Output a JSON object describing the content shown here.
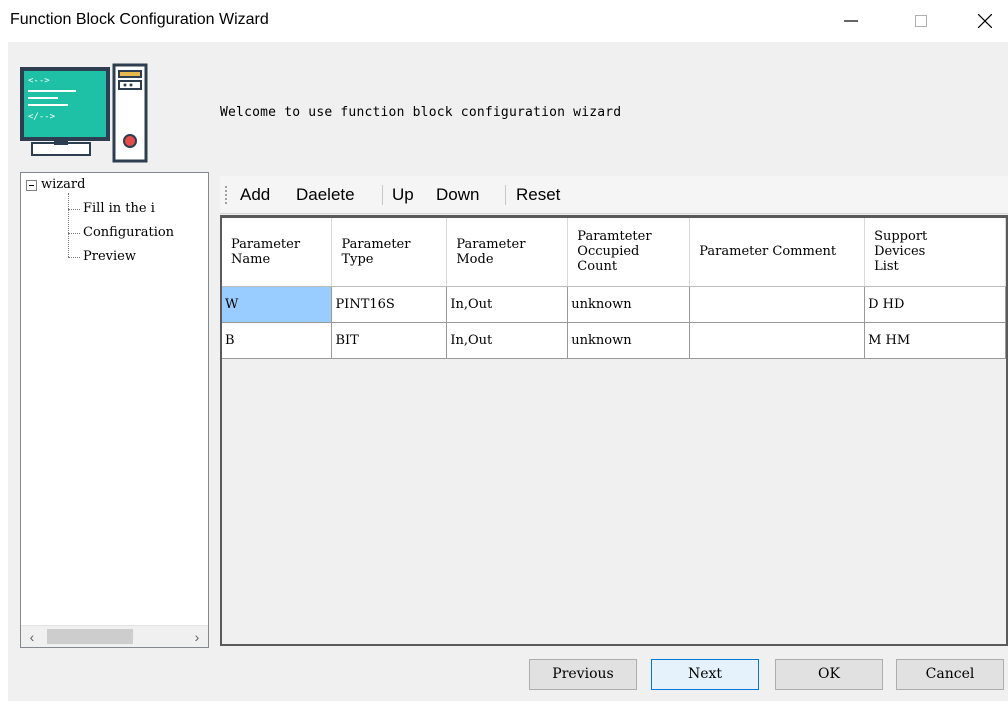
{
  "window": {
    "title": "Function Block Configuration Wizard",
    "minimize_glyph": "—",
    "maximize_glyph": "☐",
    "close_glyph": "✕"
  },
  "header": {
    "welcome_text": "Welcome to use function block configuration wizard",
    "logo_icon": "computer-code-icon"
  },
  "tree": {
    "root_label": "wizard",
    "items": [
      {
        "label": "Fill in the i"
      },
      {
        "label": "Configuration"
      },
      {
        "label": "Preview"
      }
    ]
  },
  "scrollbar": {
    "left_glyph": "‹",
    "right_glyph": "›"
  },
  "toolbar": {
    "buttons": [
      "Add",
      "Daelete",
      "Up",
      "Down",
      "Reset"
    ]
  },
  "table": {
    "columns": [
      "Parameter\nName",
      "Parameter\nType",
      "Parameter\nMode",
      "Paramteter\nOccupied\nCount",
      "Parameter Comment",
      "Support\nDevices\nList"
    ],
    "rows": [
      [
        "W",
        "PINT16S",
        "In,Out",
        "unknown",
        "",
        "D HD"
      ],
      [
        "B",
        "BIT",
        "In,Out",
        "unknown",
        "",
        "M HM"
      ]
    ]
  },
  "footer": {
    "previous": "Previous",
    "next": "Next",
    "ok": "OK",
    "cancel": "Cancel"
  },
  "colors": {
    "selected_cell": "#99ccff",
    "logo_screen": "#1ec0a6",
    "logo_frame": "#2c3e50",
    "logo_accent": "#e94b4b"
  }
}
